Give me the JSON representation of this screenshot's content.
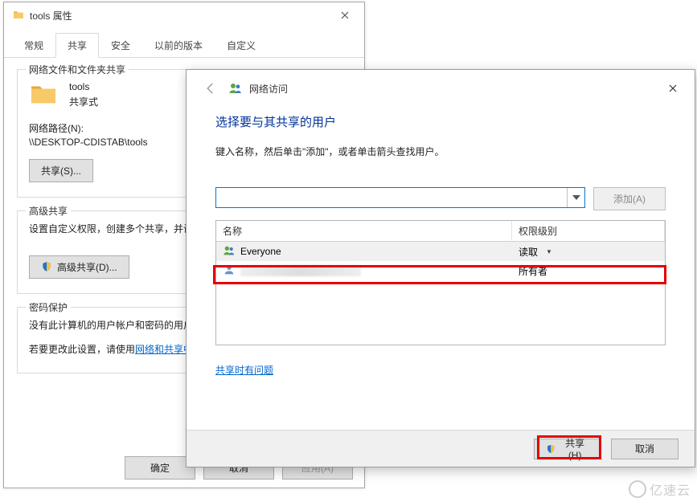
{
  "props": {
    "title": "tools 属性",
    "tabs": [
      "常规",
      "共享",
      "安全",
      "以前的版本",
      "自定义"
    ],
    "active_tab_index": 1,
    "group_netshare": {
      "legend": "网络文件和文件夹共享",
      "folder_name": "tools",
      "share_state": "共享式",
      "path_label": "网络路径(N):",
      "path_value": "\\\\DESKTOP-CDISTAB\\tools",
      "share_button": "共享(S)..."
    },
    "group_advanced": {
      "legend": "高级共享",
      "desc": "设置自定义权限，创建多个共享，并设置其他高级共享选项。",
      "button": "高级共享(D)..."
    },
    "group_password": {
      "legend": "密码保护",
      "line1": "没有此计算机的用户帐户和密码的用户可以访问与所有人共享的文件夹。",
      "line2_prefix": "若要更改此设置，请使用",
      "line2_link": "网络和共享中心"
    },
    "footer": {
      "ok": "确定",
      "cancel": "取消",
      "apply": "应用(A)"
    }
  },
  "wizard": {
    "small_title": "网络访问",
    "heading": "选择要与其共享的用户",
    "instruction": "键入名称，然后单击\"添加\"，或者单击箭头查找用户。",
    "add_button": "添加(A)",
    "columns": {
      "name": "名称",
      "level": "权限级别"
    },
    "rows": [
      {
        "name": "Everyone",
        "level": "读取",
        "has_dropdown": true,
        "selected": true,
        "icon": "users-icon"
      },
      {
        "name": "",
        "level": "所有者",
        "has_dropdown": false,
        "selected": false,
        "redacted": true,
        "icon": "user-icon"
      }
    ],
    "trouble_link": "共享时有问题",
    "footer": {
      "share": "共享(H)",
      "cancel": "取消"
    }
  },
  "watermark": "亿速云"
}
